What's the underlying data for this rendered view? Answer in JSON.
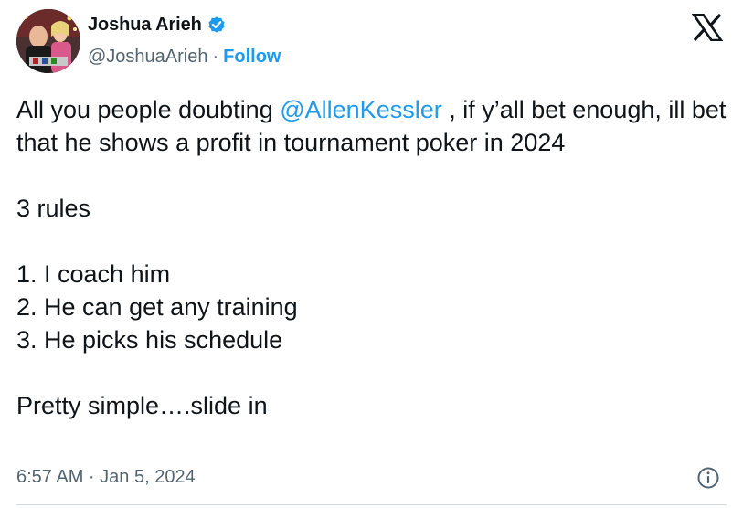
{
  "author": {
    "name": "Joshua Arieh",
    "handle": "@JoshuaArieh",
    "separator": "·",
    "follow_label": "Follow",
    "verified": true
  },
  "icons": {
    "verified": "verified-badge-icon",
    "brand": "x-logo-icon",
    "info": "info-icon"
  },
  "tweet": {
    "text_part1": "All you people doubting ",
    "mention": "@AllenKessler",
    "text_part2": " , if y’all bet enough, ill bet that he shows a profit in tournament poker in 2024\n\n3 rules\n\n1. I coach him\n2. He can get any training\n3. He picks his schedule\n\nPretty simple….slide in",
    "timestamp": "6:57 AM · Jan 5, 2024"
  },
  "colors": {
    "accent": "#1d9bf0",
    "text": "#0f1419",
    "muted": "#536471",
    "divider": "#cfd9de"
  }
}
